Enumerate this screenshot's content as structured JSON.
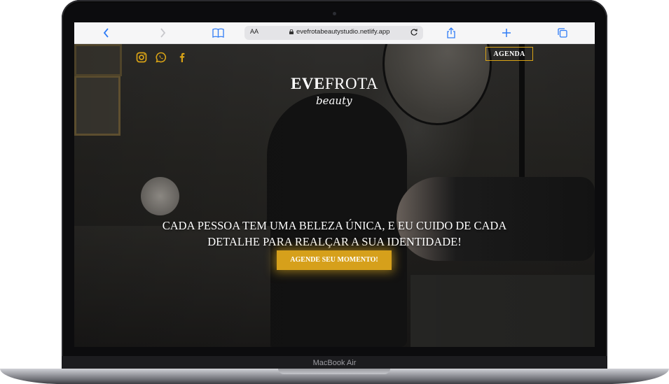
{
  "browser": {
    "back_icon": "chevron-left-icon",
    "forward_icon": "chevron-right-icon",
    "bookmarks_icon": "book-icon",
    "text_size_label": "AA",
    "url": "evefrotabeautystudio.netlify.app",
    "reload_icon": "reload-icon",
    "share_icon": "share-icon",
    "new_tab_icon": "plus-icon",
    "tabs_icon": "tabs-icon"
  },
  "site": {
    "social_icons": [
      "instagram-icon",
      "whatsapp-icon",
      "facebook-icon"
    ],
    "agenda_label": "AGENDA",
    "logo_bold": "EVE",
    "logo_rest": "FROTA",
    "logo_sub": "beauty",
    "headline_line1": "CADA PESSOA TEM UMA BELEZA ÚNICA, E EU CUIDO DE CADA",
    "headline_line2": "DETALHE PARA REALÇAR A SUA IDENTIDADE!",
    "cta_label": "AGENDE SEU MOMENTO!",
    "accent_color": "#d6a01b"
  },
  "device": {
    "label": "MacBook Air"
  }
}
